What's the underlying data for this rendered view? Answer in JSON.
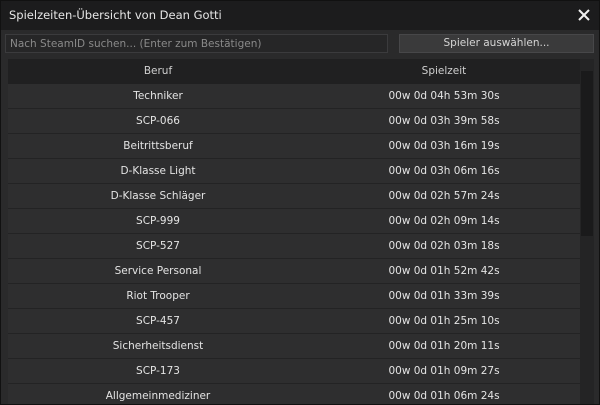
{
  "window": {
    "title": "Spielzeiten-Übersicht von Dean Gotti"
  },
  "toolbar": {
    "search_placeholder": "Nach SteamID suchen... (Enter zum Bestätigen)",
    "select_player_label": "Spieler auswählen..."
  },
  "table": {
    "columns": [
      "Beruf",
      "Spielzeit"
    ],
    "rows": [
      {
        "job": "Techniker",
        "time": "00w 0d 04h 53m 30s"
      },
      {
        "job": "SCP-066",
        "time": "00w 0d 03h 39m 58s"
      },
      {
        "job": "Beitrittsberuf",
        "time": "00w 0d 03h 16m 19s"
      },
      {
        "job": "D-Klasse Light",
        "time": "00w 0d 03h 06m 16s"
      },
      {
        "job": "D-Klasse Schläger",
        "time": "00w 0d 02h 57m 24s"
      },
      {
        "job": "SCP-999",
        "time": "00w 0d 02h 09m 14s"
      },
      {
        "job": "SCP-527",
        "time": "00w 0d 02h 03m 18s"
      },
      {
        "job": "Service Personal",
        "time": "00w 0d 01h 52m 42s"
      },
      {
        "job": "Riot Trooper",
        "time": "00w 0d 01h 33m 39s"
      },
      {
        "job": "SCP-457",
        "time": "00w 0d 01h 25m 10s"
      },
      {
        "job": "Sicherheitsdienst",
        "time": "00w 0d 01h 20m 11s"
      },
      {
        "job": "SCP-173",
        "time": "00w 0d 01h 09m 27s"
      },
      {
        "job": "Allgemeinmediziner",
        "time": "00w 0d 01h 06m 24s"
      }
    ]
  },
  "icons": {
    "close": "close-icon"
  }
}
